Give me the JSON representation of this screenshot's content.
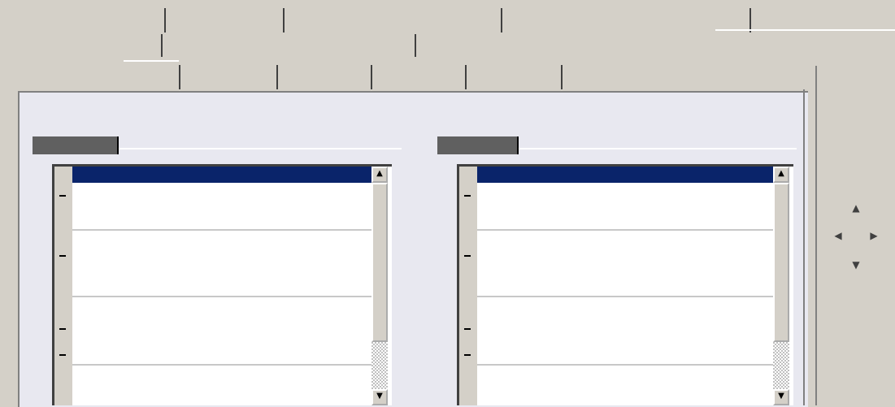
{
  "tabs_row1": [
    {
      "label": ""
    },
    {
      "label": ""
    },
    {
      "label": ""
    },
    {
      "label": ""
    },
    {
      "label": ""
    }
  ],
  "tabs_row2": [
    {
      "label": ""
    },
    {
      "label": ""
    },
    {
      "label": ""
    },
    {
      "label": ""
    }
  ],
  "tabs_row3": [
    {
      "label": ""
    },
    {
      "label": ""
    },
    {
      "label": ""
    },
    {
      "label": ""
    },
    {
      "label": ""
    },
    {
      "label": ""
    }
  ],
  "left_group": {
    "label": "",
    "rows": [
      {
        "name": "",
        "value": ""
      },
      {
        "name": "",
        "value": ""
      },
      {
        "name": "",
        "value": ""
      },
      {
        "name": "",
        "value": ""
      },
      {
        "name": "",
        "value": ""
      },
      {
        "name": "",
        "value": ""
      },
      {
        "name": "",
        "value": ""
      },
      {
        "name": "",
        "value": ""
      },
      {
        "name": "",
        "value": ""
      },
      {
        "name": "",
        "value": ""
      },
      {
        "name": "",
        "value": ""
      },
      {
        "name": "",
        "value": ""
      },
      {
        "name": "",
        "value": ""
      }
    ]
  },
  "right_group": {
    "label": "",
    "rows": [
      {
        "name": "",
        "value": ""
      },
      {
        "name": "",
        "value": ""
      },
      {
        "name": "",
        "value": ""
      },
      {
        "name": "",
        "value": ""
      },
      {
        "name": "",
        "value": ""
      },
      {
        "name": "",
        "value": ""
      },
      {
        "name": "",
        "value": ""
      },
      {
        "name": "",
        "value": ""
      },
      {
        "name": "",
        "value": ""
      },
      {
        "name": "",
        "value": ""
      },
      {
        "name": "",
        "value": ""
      },
      {
        "name": "",
        "value": ""
      },
      {
        "name": "",
        "value": ""
      }
    ]
  },
  "scroll": {
    "up_arrow": "▲",
    "down_arrow": "▼"
  },
  "side_arrows": {
    "up": "▲",
    "left": "◀",
    "right": "▶",
    "down": "▼"
  }
}
